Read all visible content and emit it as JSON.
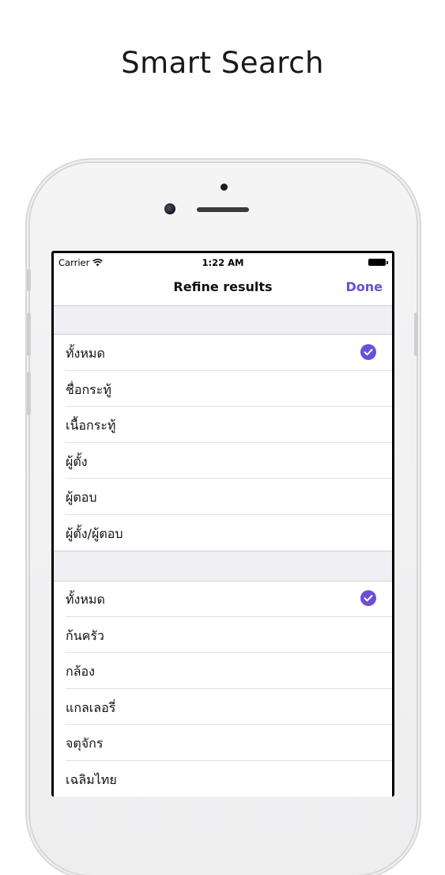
{
  "headline": "Smart Search",
  "status_bar": {
    "carrier": "Carrier",
    "time": "1:22 AM"
  },
  "nav": {
    "title": "Refine results",
    "done_label": "Done"
  },
  "accent_color": "#6b4fd8",
  "section1": {
    "items": [
      {
        "label": "ทั้งหมด",
        "selected": true
      },
      {
        "label": "ชื่อกระทู้",
        "selected": false
      },
      {
        "label": "เนื้อกระทู้",
        "selected": false
      },
      {
        "label": "ผู้ตั้ง",
        "selected": false
      },
      {
        "label": "ผู้ตอบ",
        "selected": false
      },
      {
        "label": "ผู้ตั้ง/ผู้ตอบ",
        "selected": false
      }
    ]
  },
  "section2": {
    "items": [
      {
        "label": "ทั้งหมด",
        "selected": true
      },
      {
        "label": "ก้นครัว",
        "selected": false
      },
      {
        "label": "กล้อง",
        "selected": false
      },
      {
        "label": "แกลเลอรี่",
        "selected": false
      },
      {
        "label": "จตุจักร",
        "selected": false
      },
      {
        "label": "เฉลิมไทย",
        "selected": false
      }
    ]
  }
}
